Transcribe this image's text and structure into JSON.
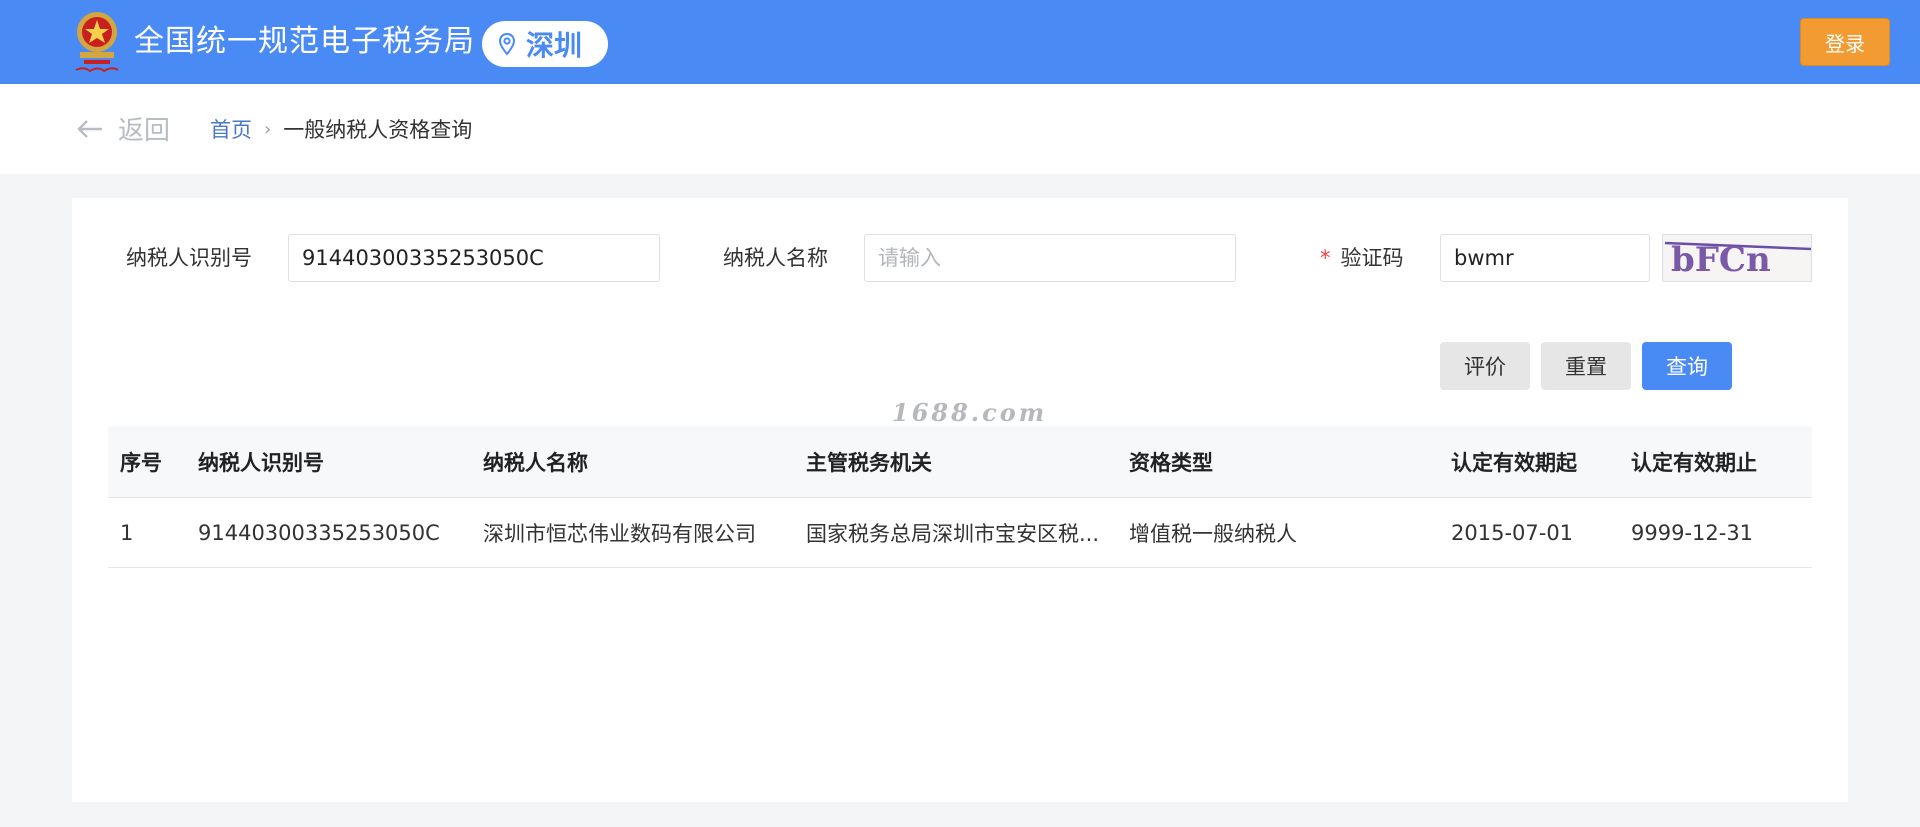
{
  "header": {
    "site_title": "全国统一规范电子税务局",
    "city": "深圳",
    "login_label": "登录"
  },
  "breadcrumb": {
    "back_label": "返回",
    "home": "首页",
    "separator": "›",
    "current": "一般纳税人资格查询"
  },
  "form": {
    "taxpayer_id_label": "纳税人识别号",
    "taxpayer_id_value": "91440300335253050C",
    "taxpayer_name_label": "纳税人名称",
    "taxpayer_name_placeholder": "请输入",
    "captcha_required_mark": "*",
    "captcha_label": "验证码",
    "captcha_value": "bwmr",
    "captcha_image_text": "bFCn"
  },
  "buttons": {
    "evaluate": "评价",
    "reset": "重置",
    "query": "查询"
  },
  "watermark": "1688.com",
  "table": {
    "headers": [
      "序号",
      "纳税人识别号",
      "纳税人名称",
      "主管税务机关",
      "资格类型",
      "认定有效期起",
      "认定有效期止"
    ],
    "rows": [
      [
        "1",
        "91440300335253050C",
        "深圳市恒芯伟业数码有限公司",
        "国家税务总局深圳市宝安区税...",
        "增值税一般纳税人",
        "2015-07-01",
        "9999-12-31"
      ]
    ]
  },
  "colors": {
    "header_bg": "#4a8af4",
    "login_bg": "#f29b33",
    "primary": "#4a8af4",
    "link": "#4a78c4",
    "required": "#f04444"
  }
}
